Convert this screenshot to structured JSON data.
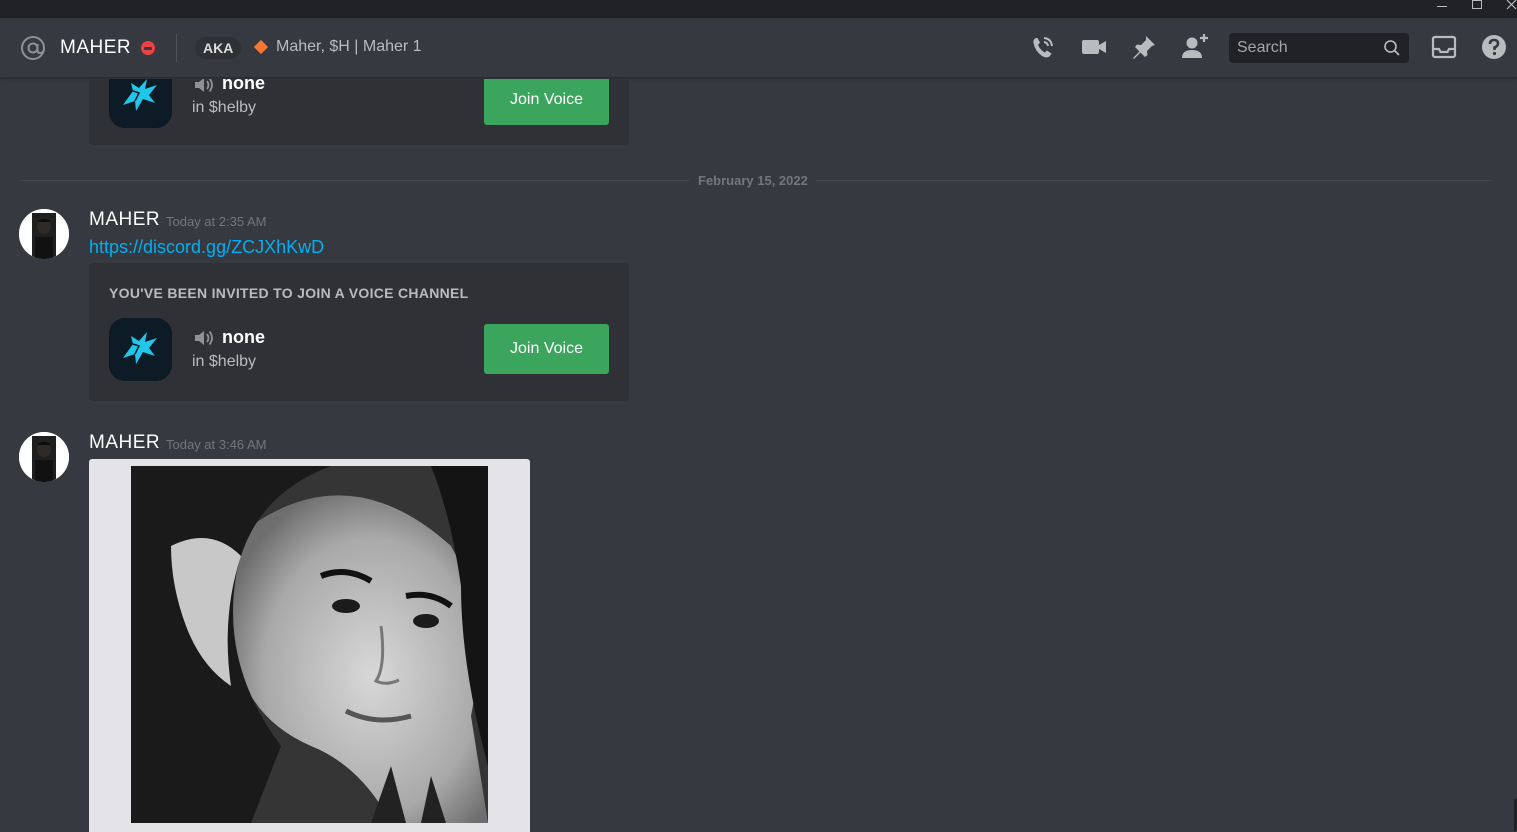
{
  "window": {
    "minimize_icon": "minimize-icon",
    "maximize_icon": "maximize-icon",
    "close_icon": "close-icon"
  },
  "header": {
    "icon": "at-icon",
    "username": "MAHER",
    "status": "do-not-disturb",
    "aka_label": "AKA",
    "nicknames": "Maher, $H | Maher 1",
    "search_placeholder": "Search",
    "actions": [
      "voice-call-icon",
      "video-call-icon",
      "pin-icon",
      "add-friend-icon",
      "inbox-icon",
      "help-icon"
    ]
  },
  "date_divider": "February 15, 2022",
  "messages": [
    {
      "embed": {
        "channel_name": "none",
        "guild": "in $helby",
        "button": "Join Voice"
      }
    },
    {
      "author": "MAHER",
      "timestamp": "Today at 2:35 AM",
      "link": "https://discord.gg/ZCJXhKwD",
      "embed": {
        "title": "YOU'VE BEEN INVITED TO JOIN A VOICE CHANNEL",
        "channel_name": "none",
        "guild": "in $helby",
        "button": "Join Voice"
      }
    },
    {
      "author": "MAHER",
      "timestamp": "Today at 3:46 AM",
      "attachment": "image"
    }
  ],
  "colors": {
    "background": "#36393f",
    "embed": "#2f3136",
    "join_button": "#3ba55d",
    "link": "#00aff4",
    "dnd": "#ed4245"
  }
}
